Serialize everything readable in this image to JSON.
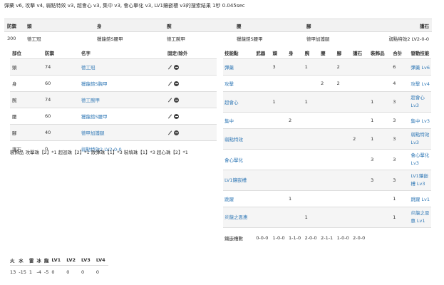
{
  "header": "彈藥 v6, 攻擊 v4, 弱點特效 v3, 超會心 v3, 集中 v3, 會心擊化 v3, LV1鑲嵌槽 v3的搜索結果 1秒 0.045sec",
  "equipment": {
    "columns": [
      "防禦",
      "頭",
      "身",
      "腕",
      "腰",
      "腳",
      "護石"
    ],
    "values": [
      "300",
      "德工冠",
      "獵龍鎧S腰甲",
      "德工腕甲",
      "獵龍鎧S腰甲",
      "德甲加護腿",
      "弱點特效2 LV2-0-0"
    ]
  },
  "left_table": {
    "headers": [
      "部位",
      "防禦",
      "名字",
      "固定/除外"
    ],
    "rows": [
      {
        "part": "頭",
        "def": "74",
        "name": "德工冠"
      },
      {
        "part": "身",
        "def": "60",
        "name": "獵龍鎧S胸甲"
      },
      {
        "part": "腕",
        "def": "74",
        "name": "德工腕甲"
      },
      {
        "part": "腰",
        "def": "60",
        "name": "獵龍鎧S腰甲"
      },
      {
        "part": "腳",
        "def": "40",
        "name": "德甲加護腿"
      },
      {
        "part": "護石",
        "def": "0",
        "name": "弱點特效2 LV2-0-0"
      }
    ],
    "decorations": "裝飾品   攻擊珠【2】*1 超迴珠【2】*1 散彈珠【1】*3 裝填珠【1】*3 超心珠【2】*1"
  },
  "right_table": {
    "headers": [
      "技能點",
      "武器",
      "頭",
      "身",
      "腕",
      "腰",
      "腳",
      "護石",
      "裝飾品",
      "合計",
      "發動技能"
    ],
    "rows": [
      {
        "c": [
          "彈藥",
          "",
          "3",
          "",
          "1",
          "",
          "2",
          "",
          "",
          "6"
        ],
        "skill": "彈藥 Lv6"
      },
      {
        "c": [
          "攻擊",
          "",
          "",
          "",
          "",
          "2",
          "2",
          "",
          "",
          "4"
        ],
        "skill": "攻擊 Lv4"
      },
      {
        "c": [
          "超會心",
          "",
          "1",
          "",
          "1",
          "",
          "",
          "",
          "1",
          "3"
        ],
        "skill": "超會心 Lv3"
      },
      {
        "c": [
          "集中",
          "",
          "",
          "2",
          "",
          "",
          "",
          "",
          "1",
          "3"
        ],
        "skill": "集中 Lv3"
      },
      {
        "c": [
          "弱點特效",
          "",
          "",
          "",
          "",
          "",
          "",
          "2",
          "1",
          "3"
        ],
        "skill": "弱點特效 Lv3"
      },
      {
        "c": [
          "會心擊化",
          "",
          "",
          "",
          "",
          "",
          "",
          "",
          "3",
          "3"
        ],
        "skill": "會心擊化 Lv3"
      },
      {
        "c": [
          "LV1鑲嵌槽",
          "",
          "",
          "",
          "",
          "",
          "",
          "",
          "3",
          "3"
        ],
        "skill": "LV1鑲嵌槽 Lv3"
      },
      {
        "c": [
          "跳躍",
          "",
          "",
          "1",
          "",
          "",
          "",
          "",
          "",
          "1"
        ],
        "skill": "跳躍 Lv1"
      },
      {
        "c": [
          "炎龍之恩惠",
          "",
          "",
          "",
          "1",
          "",
          "",
          "",
          "",
          "1"
        ],
        "skill": "炎龍之恩惠 Lv1"
      }
    ],
    "slots": {
      "label": "鑲嵌槽數",
      "values": [
        "0-0-0",
        "1-0-0",
        "1-1-0",
        "2-0-0",
        "2-1-1",
        "1-0-0",
        "2-0-0"
      ]
    }
  },
  "resist": {
    "headers": [
      "火",
      "水",
      "雷",
      "冰",
      "龍",
      "LV1",
      "LV2",
      "LV3",
      "LV4"
    ],
    "values": [
      "13",
      "-15",
      "1",
      "-4",
      "-5",
      "0",
      "0",
      "0",
      "0"
    ]
  }
}
